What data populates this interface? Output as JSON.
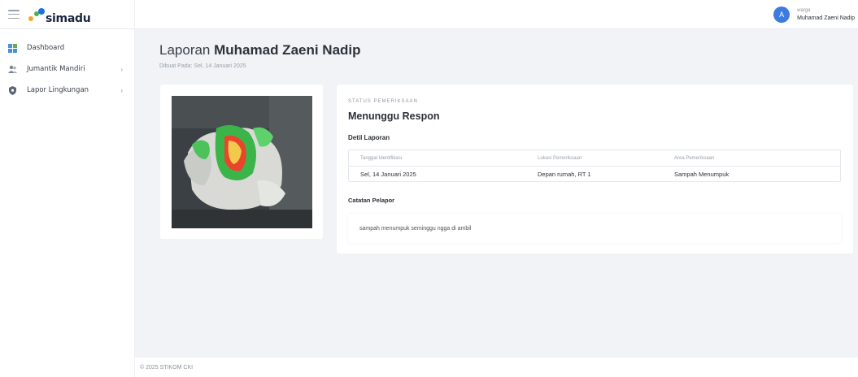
{
  "app": {
    "name": "simadu",
    "colors": {
      "primary": "#3d7be0",
      "logo_orange": "#f5a623",
      "logo_green": "#4caf50",
      "logo_blue": "#1f6fe0"
    }
  },
  "header": {
    "menu_icon": "hamburger-icon",
    "user": {
      "initial": "A",
      "role": "warga",
      "name": "Muhamad Zaeni Nadip"
    },
    "dropdown_icon": "chevron-down-icon"
  },
  "sidebar": {
    "items": [
      {
        "label": "Dashboard",
        "icon": "dashboard-grid-icon",
        "has_submenu": false
      },
      {
        "label": "Jumantik Mandiri",
        "icon": "users-icon",
        "has_submenu": true,
        "chevron": "›"
      },
      {
        "label": "Lapor Lingkungan",
        "icon": "shield-icon",
        "has_submenu": true,
        "chevron": "›"
      }
    ]
  },
  "main": {
    "title_prefix": "Laporan",
    "title_name": "Muhamad Zaeni Nadip",
    "created": "Dibuat Pada: Sel, 14 Januari 2025",
    "photo_alt": "Foto sampah menumpuk",
    "status_label": "STATUS PEMERIKSAAN",
    "status_value": "Menunggu Respon",
    "detail_title": "Detil Laporan",
    "table": {
      "headers": [
        "Tanggal Identifikasi",
        "Lokasi Pemeriksaan",
        "Area Pemeriksaan"
      ],
      "row": [
        "Sel, 14 Januari 2025",
        "Depan rumah, RT 1",
        "Sampah Menumpuk"
      ]
    },
    "note_title": "Catatan Pelapor",
    "note_text": "sampah menumpuk seminggu ngga di ambil"
  },
  "footer": {
    "text": "© 2025 STIKOM CKI"
  }
}
